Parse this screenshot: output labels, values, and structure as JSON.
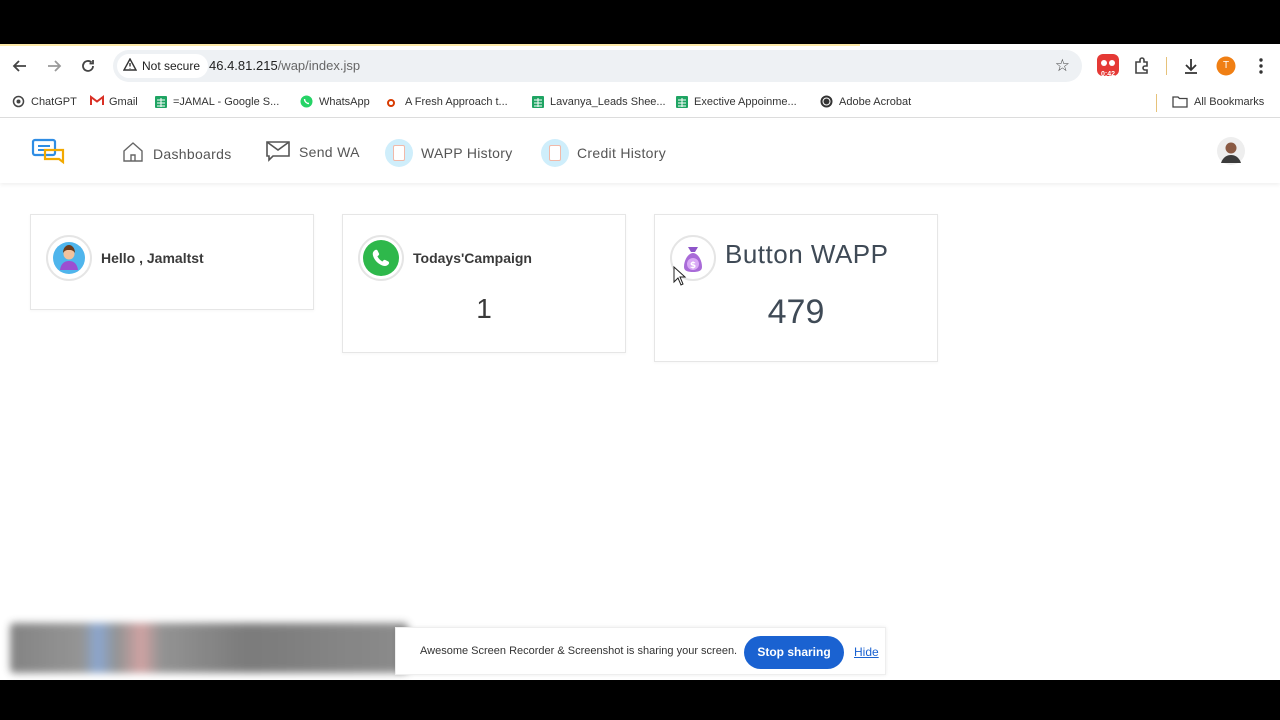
{
  "browser": {
    "security_label": "Not secure",
    "url_host": "46.4.81.215",
    "url_path": "/wap/index.jsp",
    "recorder_badge": "0:42",
    "profile_initial": "T",
    "bookmarks": [
      {
        "label": "ChatGPT",
        "icon": "chatgpt-icon"
      },
      {
        "label": "Gmail",
        "icon": "gmail-icon"
      },
      {
        "label": "=JAMAL - Google S...",
        "icon": "sheets-icon"
      },
      {
        "label": "WhatsApp",
        "icon": "whatsapp-icon"
      },
      {
        "label": "A Fresh Approach t...",
        "icon": "office-icon"
      },
      {
        "label": "Lavanya_Leads Shee...",
        "icon": "sheets-icon"
      },
      {
        "label": "Exective Appoinme...",
        "icon": "sheets-icon"
      },
      {
        "label": "Adobe Acrobat",
        "icon": "globe-icon"
      }
    ],
    "all_bookmarks_label": "All Bookmarks"
  },
  "nav": {
    "items": [
      {
        "label": "Dashboards",
        "icon": "home-icon"
      },
      {
        "label": "Send WA",
        "icon": "mail-icon"
      },
      {
        "label": "WAPP History",
        "icon": "clipboard-icon"
      },
      {
        "label": "Credit History",
        "icon": "clipboard-icon"
      }
    ]
  },
  "cards": {
    "greeting": {
      "title": "Hello , Jamaltst",
      "icon": "user-avatar-icon"
    },
    "campaign": {
      "title": "Todays'Campaign",
      "value": "1",
      "icon": "whatsapp-icon"
    },
    "button_wapp": {
      "title": "Button WAPP",
      "value": "479",
      "icon": "money-bag-icon"
    }
  },
  "sharing": {
    "message": "Awesome Screen Recorder & Screenshot is sharing your screen.",
    "stop_label": "Stop sharing",
    "hide_label": "Hide"
  },
  "colors": {
    "accent_blue": "#1a62d1",
    "whatsapp_green": "#2eb84b",
    "money_purple": "#a96bd8"
  }
}
